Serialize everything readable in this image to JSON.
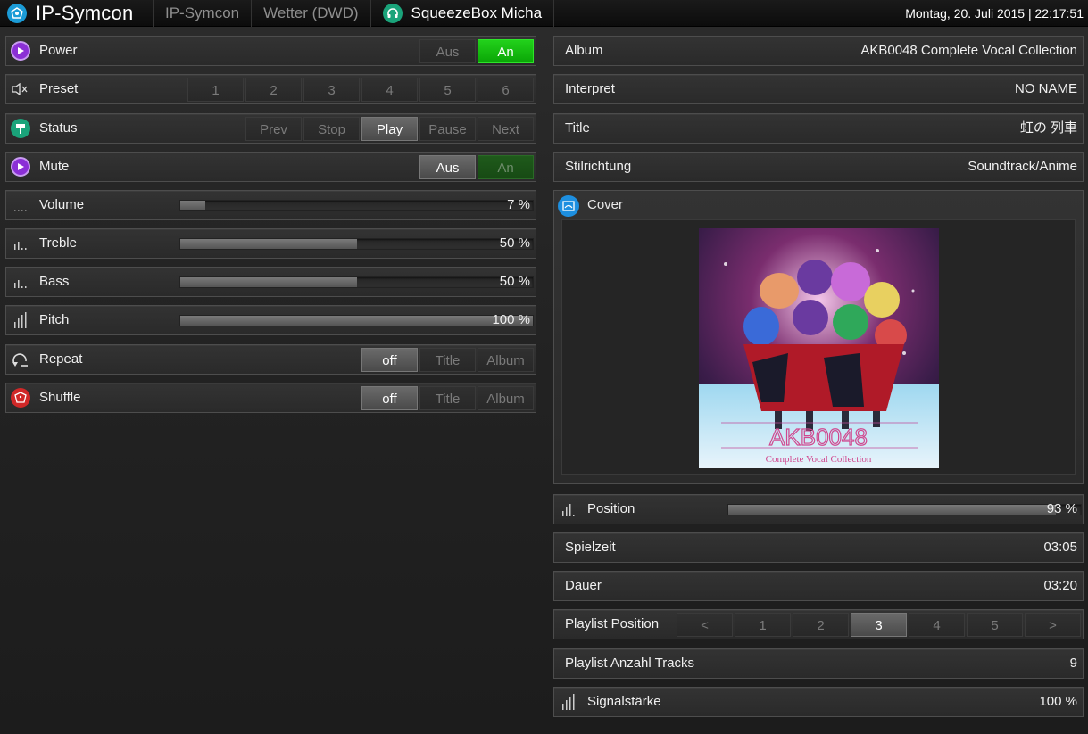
{
  "header": {
    "brand": "IP-Symcon",
    "tabs": [
      {
        "label": "IP-Symcon"
      },
      {
        "label": "Wetter (DWD)"
      },
      {
        "label": "SqueezeBox Micha"
      }
    ],
    "datetime": "Montag, 20. Juli 2015 | 22:17:51"
  },
  "left": {
    "power": {
      "label": "Power",
      "buttons": [
        "Aus",
        "An"
      ]
    },
    "preset": {
      "label": "Preset",
      "buttons": [
        "1",
        "2",
        "3",
        "4",
        "5",
        "6"
      ]
    },
    "status": {
      "label": "Status",
      "buttons": [
        "Prev",
        "Stop",
        "Play",
        "Pause",
        "Next"
      ]
    },
    "mute": {
      "label": "Mute",
      "buttons": [
        "Aus",
        "An"
      ]
    },
    "volume": {
      "label": "Volume",
      "value": "7 %",
      "level": 0.07
    },
    "treble": {
      "label": "Treble",
      "value": "50 %",
      "level": 0.5
    },
    "bass": {
      "label": "Bass",
      "value": "50 %",
      "level": 0.5
    },
    "pitch": {
      "label": "Pitch",
      "value": "100 %",
      "level": 1.0
    },
    "repeat": {
      "label": "Repeat",
      "buttons": [
        "off",
        "Title",
        "Album"
      ]
    },
    "shuffle": {
      "label": "Shuffle",
      "buttons": [
        "off",
        "Title",
        "Album"
      ]
    }
  },
  "right": {
    "album": {
      "label": "Album",
      "value": "AKB0048 Complete Vocal Collection"
    },
    "interpret": {
      "label": "Interpret",
      "value": "NO NAME"
    },
    "title": {
      "label": "Title",
      "value": "虹の 列車"
    },
    "stilrichtung": {
      "label": "Stilrichtung",
      "value": "Soundtrack/Anime"
    },
    "cover": {
      "label": "Cover",
      "art_logo": "AKB0048",
      "art_subtitle": "Complete Vocal Collection"
    },
    "position": {
      "label": "Position",
      "value": "93 %",
      "level": 0.93
    },
    "spielzeit": {
      "label": "Spielzeit",
      "value": "03:05"
    },
    "dauer": {
      "label": "Dauer",
      "value": "03:20"
    },
    "playlist_position": {
      "label": "Playlist Position",
      "buttons": [
        "<",
        "1",
        "2",
        "3",
        "4",
        "5",
        ">"
      ]
    },
    "playlist_tracks": {
      "label": "Playlist Anzahl Tracks",
      "value": "9"
    },
    "signal": {
      "label": "Signalstärke",
      "value": "100 %"
    }
  },
  "colors": {
    "accent_green": "#12c00c",
    "power_purple": "#8b2fd6",
    "status_teal": "#1aa37a",
    "shuffle_red": "#d02828",
    "cover_blue": "#1d8fe0"
  }
}
